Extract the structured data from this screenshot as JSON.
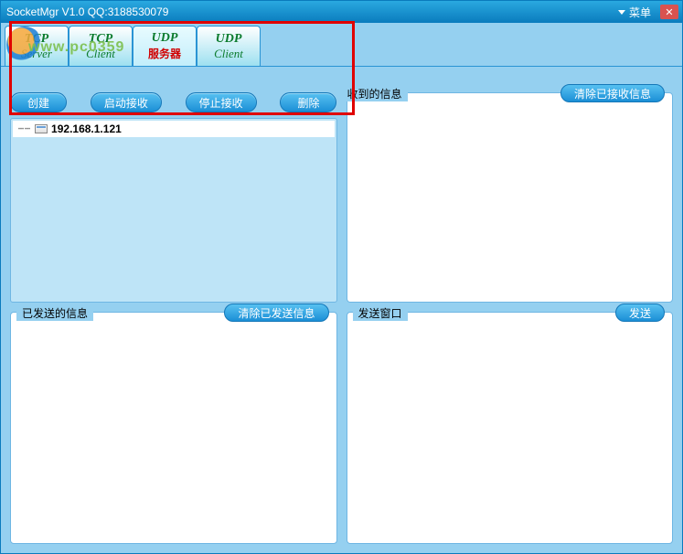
{
  "window": {
    "title": "SocketMgr V1.0  QQ:3188530079",
    "menu_label": "菜单"
  },
  "watermark": "www.pc0359",
  "tabs": [
    {
      "line1": "TCP",
      "line2": "Server",
      "line2_red": false
    },
    {
      "line1": "TCP",
      "line2": "Client",
      "line2_red": false
    },
    {
      "line1": "UDP",
      "line2": "服务器",
      "line2_red": true
    },
    {
      "line1": "UDP",
      "line2": "Client",
      "line2_red": false
    }
  ],
  "active_tab_index": 2,
  "buttons": {
    "create": "创建",
    "start_recv": "启动接收",
    "stop_recv": "停止接收",
    "delete": "删除"
  },
  "connections": [
    {
      "ip": "192.168.1.121"
    }
  ],
  "panels": {
    "received": {
      "title": "收到的信息",
      "button": "清除已接收信息",
      "content": ""
    },
    "sent": {
      "title": "已发送的信息",
      "button": "清除已发送信息",
      "content": ""
    },
    "send": {
      "title": "发送窗口",
      "button": "发送",
      "content": ""
    }
  }
}
